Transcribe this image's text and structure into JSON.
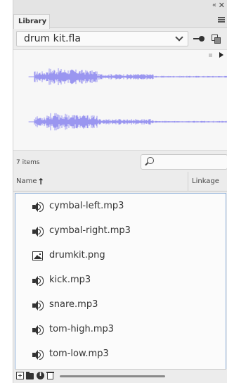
{
  "window": {
    "collapse_glyph": "«",
    "close_glyph": "✕"
  },
  "panel": {
    "tab_label": "Library"
  },
  "file_select": {
    "value": "drum kit.fla"
  },
  "library": {
    "item_count": "7 items",
    "search": {
      "value": "",
      "placeholder": ""
    },
    "columns": {
      "name": "Name",
      "sort_glyph": "↑",
      "linkage": "Linkage"
    },
    "items": [
      {
        "label": "cymbal-left.mp3",
        "icon": "speaker-icon"
      },
      {
        "label": "cymbal-right.mp3",
        "icon": "speaker-icon"
      },
      {
        "label": "drumkit.png",
        "icon": "image-icon"
      },
      {
        "label": "kick.mp3",
        "icon": "speaker-icon"
      },
      {
        "label": "snare.mp3",
        "icon": "speaker-icon"
      },
      {
        "label": "tom-high.mp3",
        "icon": "speaker-icon"
      },
      {
        "label": "tom-low.mp3",
        "icon": "speaker-icon"
      }
    ]
  },
  "colors": {
    "waveform": "#9a96f0",
    "panel_bg": "#ececec",
    "list_border": "#8fb0d9"
  }
}
